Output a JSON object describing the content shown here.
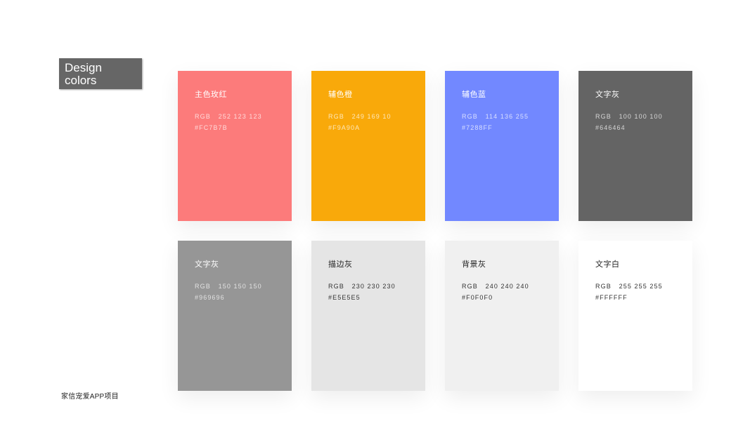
{
  "title": {
    "line1": "Design",
    "line2": "colors"
  },
  "footer": "家信宠爱APP项目",
  "swatches": [
    {
      "name": "主色玫红",
      "rgb": "RGB   252 123 123",
      "hex": "#FC7B7B",
      "color": "#FC7B7B"
    },
    {
      "name": "辅色橙",
      "rgb": "RGB   249 169 10",
      "hex": "#F9A90A",
      "color": "#F9A90A"
    },
    {
      "name": "辅色蓝",
      "rgb": "RGB   114 136 255",
      "hex": "#7288FF",
      "color": "#7288FF"
    },
    {
      "name": "文字灰",
      "rgb": "RGB   100 100 100",
      "hex": "#646464",
      "color": "#646464"
    },
    {
      "name": "文字灰",
      "rgb": "RGB   150 150 150",
      "hex": "#969696",
      "color": "#969696"
    },
    {
      "name": "描边灰",
      "rgb": "RGB   230 230 230",
      "hex": "#E5E5E5",
      "color": "#E5E5E5"
    },
    {
      "name": "背景灰",
      "rgb": "RGB   240 240 240",
      "hex": "#F0F0F0",
      "color": "#F0F0F0"
    },
    {
      "name": "文字白",
      "rgb": "RGB   255 255 255",
      "hex": "#FFFFFF",
      "color": "#FFFFFF"
    }
  ]
}
